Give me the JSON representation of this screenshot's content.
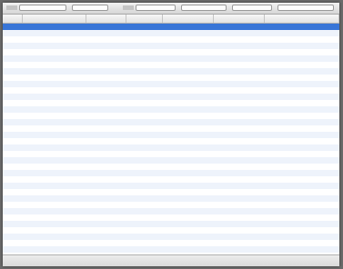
{
  "colors": {
    "window_bg": "#ffffff",
    "selection": "#3875d7",
    "selected_text": "#ffffff",
    "text": "#222222",
    "past_due_text": "#d22424",
    "row_stripe": "#eef3fb"
  },
  "toolbar": {
    "controls": [
      {
        "kind": "label",
        "text": ""
      },
      {
        "kind": "select",
        "value": ""
      },
      {
        "kind": "select",
        "value": ""
      },
      {
        "kind": "label",
        "text": ""
      },
      {
        "kind": "select",
        "value": ""
      },
      {
        "kind": "select",
        "value": ""
      },
      {
        "kind": "select",
        "value": ""
      },
      {
        "kind": "select",
        "value": ""
      }
    ]
  },
  "table": {
    "columns": [
      {
        "header": "",
        "align": "left"
      },
      {
        "header": "",
        "align": "left"
      },
      {
        "header": "",
        "align": "left"
      },
      {
        "header": "",
        "align": "left"
      },
      {
        "header": "",
        "align": "left"
      },
      {
        "header": "",
        "align": "left"
      },
      {
        "header": "",
        "align": "right"
      }
    ],
    "rows": [
      {
        "state": "selected",
        "cells": [
          "",
          "",
          "",
          "",
          "",
          "",
          ""
        ]
      },
      {
        "state": "normal",
        "cells": [
          "",
          "",
          "",
          "",
          "",
          "",
          ""
        ]
      },
      {
        "state": "normal",
        "cells": [
          "",
          "",
          "",
          "",
          "",
          "",
          ""
        ]
      },
      {
        "state": "normal",
        "cells": [
          "",
          "",
          "",
          "",
          "",
          "",
          ""
        ]
      },
      {
        "state": "normal",
        "cells": [
          "",
          "",
          "",
          "",
          "",
          "",
          ""
        ]
      },
      {
        "state": "normal",
        "cells": [
          "",
          "",
          "",
          "",
          "",
          "",
          ""
        ]
      },
      {
        "state": "normal",
        "cells": [
          "",
          "",
          "",
          "",
          "",
          "",
          ""
        ]
      },
      {
        "state": "normal",
        "cells": [
          "",
          "",
          "",
          "",
          "",
          "",
          ""
        ]
      },
      {
        "state": "normal",
        "cells": [
          "",
          "",
          "",
          "",
          "",
          "",
          ""
        ]
      },
      {
        "state": "normal",
        "cells": [
          "",
          "",
          "",
          "",
          "",
          "",
          ""
        ]
      },
      {
        "state": "normal",
        "cells": [
          "",
          "",
          "",
          "",
          "",
          "",
          ""
        ]
      },
      {
        "state": "normal",
        "cells": [
          "",
          "",
          "",
          "",
          "",
          "",
          ""
        ]
      },
      {
        "state": "normal",
        "cells": [
          "",
          "",
          "",
          "",
          "",
          "",
          ""
        ]
      },
      {
        "state": "normal",
        "cells": [
          "",
          "",
          "",
          "",
          "",
          "",
          ""
        ]
      },
      {
        "state": "normal",
        "cells": [
          "",
          "",
          "",
          "",
          "",
          "",
          ""
        ]
      },
      {
        "state": "normal",
        "cells": [
          "",
          "",
          "",
          "",
          "",
          "",
          ""
        ]
      },
      {
        "state": "normal",
        "cells": [
          "",
          "",
          "",
          "",
          "",
          "",
          ""
        ]
      },
      {
        "state": "normal",
        "cells": [
          "",
          "",
          "",
          "",
          "",
          "",
          ""
        ]
      },
      {
        "state": "normal",
        "cells": [
          "",
          "",
          "",
          "",
          "",
          "",
          ""
        ]
      },
      {
        "state": "past_due",
        "cells": [
          "",
          "",
          "",
          "",
          "",
          "",
          ""
        ]
      },
      {
        "state": "normal",
        "cells": [
          "",
          "",
          "",
          "",
          "",
          "",
          ""
        ]
      },
      {
        "state": "normal",
        "cells": [
          "",
          "",
          "",
          "",
          "",
          "",
          ""
        ]
      },
      {
        "state": "normal",
        "cells": [
          "",
          "",
          "",
          "",
          "",
          "",
          ""
        ]
      },
      {
        "state": "normal",
        "cells": [
          "",
          "",
          "",
          "",
          "",
          "",
          ""
        ]
      },
      {
        "state": "normal",
        "cells": [
          "",
          "",
          "",
          "",
          "",
          "",
          ""
        ]
      },
      {
        "state": "normal",
        "cells": [
          "",
          "",
          "",
          "",
          "",
          "",
          ""
        ]
      },
      {
        "state": "normal",
        "cells": [
          "",
          "",
          "",
          "",
          "",
          "",
          ""
        ]
      },
      {
        "state": "normal",
        "cells": [
          "",
          "",
          "",
          "",
          "",
          "",
          ""
        ]
      },
      {
        "state": "normal",
        "cells": [
          "",
          "",
          "",
          "",
          "",
          "",
          ""
        ]
      },
      {
        "state": "normal",
        "cells": [
          "",
          "",
          "",
          "",
          "",
          "",
          ""
        ]
      },
      {
        "state": "past_due",
        "cells": [
          "",
          "",
          "",
          "",
          "",
          "",
          ""
        ]
      },
      {
        "state": "past_due",
        "cells": [
          "",
          "",
          "",
          "",
          "",
          "",
          ""
        ]
      },
      {
        "state": "normal",
        "cells": [
          "",
          "",
          "",
          "",
          "",
          "",
          ""
        ]
      },
      {
        "state": "normal",
        "cells": [
          "",
          "",
          "",
          "",
          "",
          "",
          ""
        ]
      },
      {
        "state": "normal",
        "cells": [
          "",
          "",
          "",
          "",
          "",
          "",
          ""
        ]
      },
      {
        "state": "past_due",
        "cells": [
          "",
          "",
          "",
          "",
          "",
          "",
          ""
        ]
      },
      {
        "state": "normal",
        "cells": [
          "",
          "",
          "",
          "",
          "",
          "",
          ""
        ]
      },
      {
        "state": "normal",
        "cells": [
          "",
          "",
          "",
          "",
          "",
          "",
          ""
        ]
      }
    ]
  },
  "footer": {
    "status": ""
  }
}
